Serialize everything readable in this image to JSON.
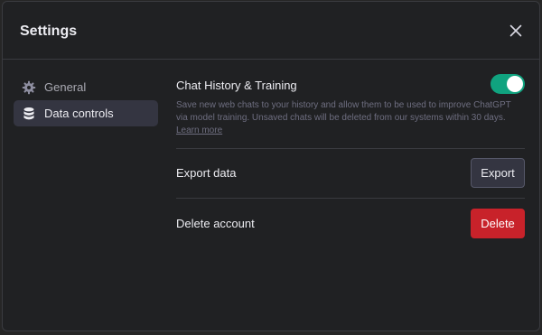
{
  "dialog": {
    "title": "Settings",
    "close_icon": "close-icon"
  },
  "sidebar": {
    "items": [
      {
        "label": "General",
        "icon": "gear-icon",
        "active": false
      },
      {
        "label": "Data controls",
        "icon": "database-icon",
        "active": true
      }
    ]
  },
  "data_controls": {
    "chat_history": {
      "title": "Chat History & Training",
      "enabled": true,
      "description": "Save new web chats to your history and allow them to be used to improve ChatGPT via model training. Unsaved chats will be deleted from our systems within 30 days.",
      "learn_more_label": "Learn more"
    },
    "export": {
      "title": "Export data",
      "button_label": "Export"
    },
    "delete": {
      "title": "Delete account",
      "button_label": "Delete"
    }
  },
  "colors": {
    "toggle_on": "#10a37f",
    "danger": "#c8222a",
    "background": "#202123"
  }
}
